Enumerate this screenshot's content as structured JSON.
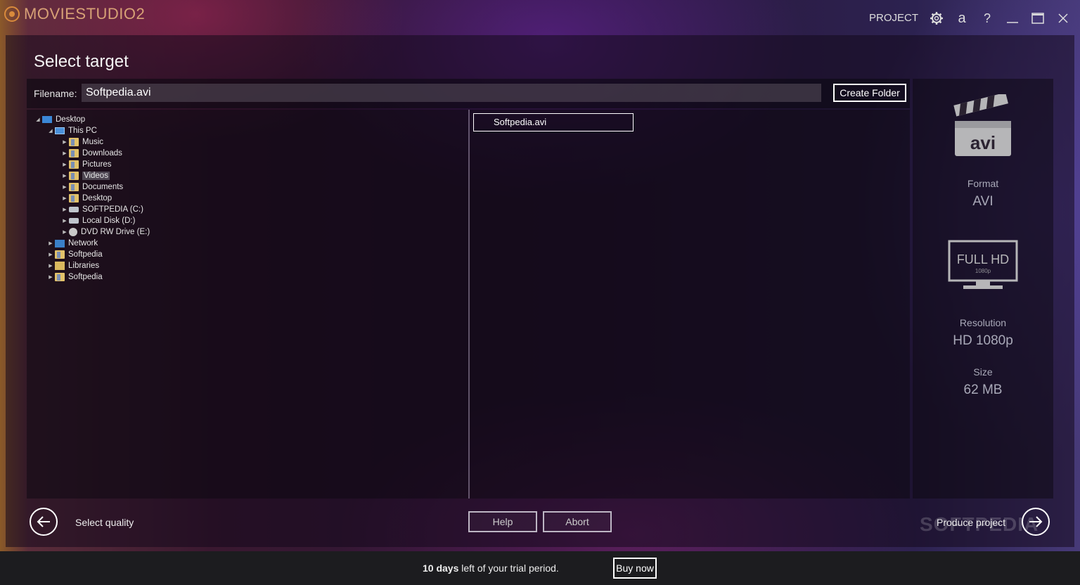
{
  "app": {
    "name": "MOVIESTUDIO2",
    "header_right": {
      "project_label": "PROJECT",
      "help_label": "?",
      "account_glyph": "a"
    }
  },
  "icons": [
    "gear-icon",
    "account-icon",
    "help-icon",
    "minimize-icon",
    "maximize-icon",
    "close-icon",
    "back-arrow-icon",
    "forward-arrow-icon",
    "clapperboard-icon",
    "monitor-icon"
  ],
  "page": {
    "title": "Select target"
  },
  "filename": {
    "label": "Filename:",
    "value": "Softpedia.avi",
    "create_folder": "Create Folder"
  },
  "tree": [
    {
      "label": "Desktop",
      "icon": "desktop",
      "level": 0,
      "expanded": true
    },
    {
      "label": "This PC",
      "icon": "pc",
      "level": 1,
      "expanded": true
    },
    {
      "label": "Music",
      "icon": "folder",
      "level": 2
    },
    {
      "label": "Downloads",
      "icon": "folder",
      "level": 2
    },
    {
      "label": "Pictures",
      "icon": "folder",
      "level": 2
    },
    {
      "label": "Videos",
      "icon": "folder",
      "level": 2,
      "selected": true
    },
    {
      "label": "Documents",
      "icon": "folder",
      "level": 2
    },
    {
      "label": "Desktop",
      "icon": "folder",
      "level": 2
    },
    {
      "label": "SOFTPEDIA (C:)",
      "icon": "drive",
      "level": 2
    },
    {
      "label": "Local Disk (D:)",
      "icon": "drive",
      "level": 2
    },
    {
      "label": "DVD RW Drive (E:)",
      "icon": "disc",
      "level": 2
    },
    {
      "label": "Network",
      "icon": "network",
      "level": 1
    },
    {
      "label": "Softpedia",
      "icon": "folder",
      "level": 1
    },
    {
      "label": "Libraries",
      "icon": "library",
      "level": 1
    },
    {
      "label": "Softpedia",
      "icon": "folder",
      "level": 1
    }
  ],
  "files": [
    {
      "name": "Softpedia.avi"
    }
  ],
  "info": {
    "format_badge": "avi",
    "format_label": "Format",
    "format_value": "AVI",
    "monitor_text": "FULL HD",
    "monitor_sub": "1080p",
    "resolution_label": "Resolution",
    "resolution_value": "HD 1080p",
    "size_label": "Size",
    "size_value": "62 MB"
  },
  "nav": {
    "back_label": "Select quality",
    "help_label": "Help",
    "abort_label": "Abort",
    "forward_label": "Produce project",
    "watermark": "SOFTPEDIA"
  },
  "trial": {
    "days": "10 days",
    "text": " left of your trial period.",
    "buy_label": "Buy now"
  }
}
